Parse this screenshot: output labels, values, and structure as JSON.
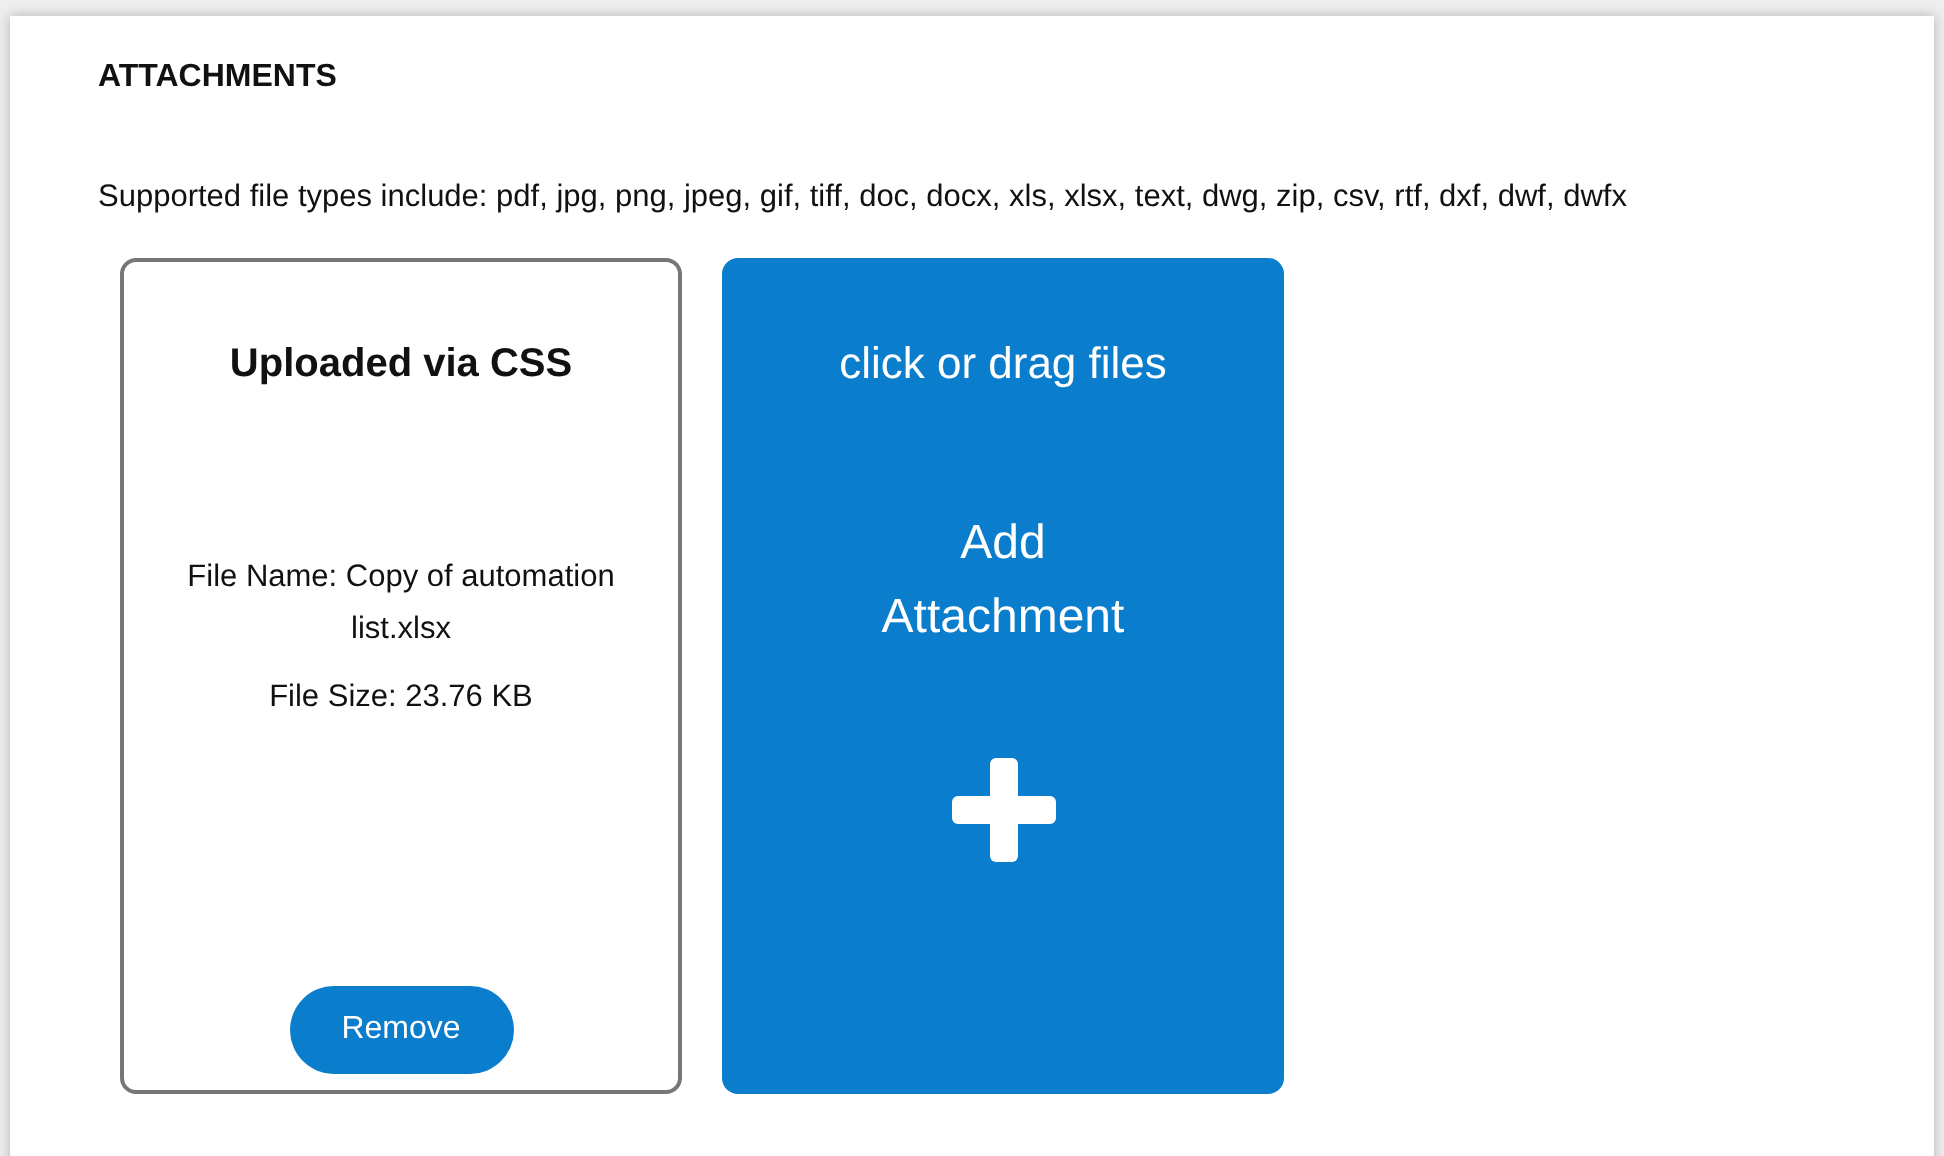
{
  "panel": {
    "title": "ATTACHMENTS",
    "supported_types": "Supported file types include: pdf, jpg, png, jpeg, gif, tiff, doc, docx, xls, xlsx, text, dwg, zip, csv, rtf, dxf, dwf, dwfx"
  },
  "attachments": [
    {
      "title": "Uploaded via CSS",
      "file_name": "File Name: Copy of automation list.xlsx",
      "file_size": "File Size: 23.76 KB",
      "remove_button": "Remove"
    }
  ],
  "upload_area": {
    "hint": "click or drag files",
    "label": "Add Attachment"
  }
}
